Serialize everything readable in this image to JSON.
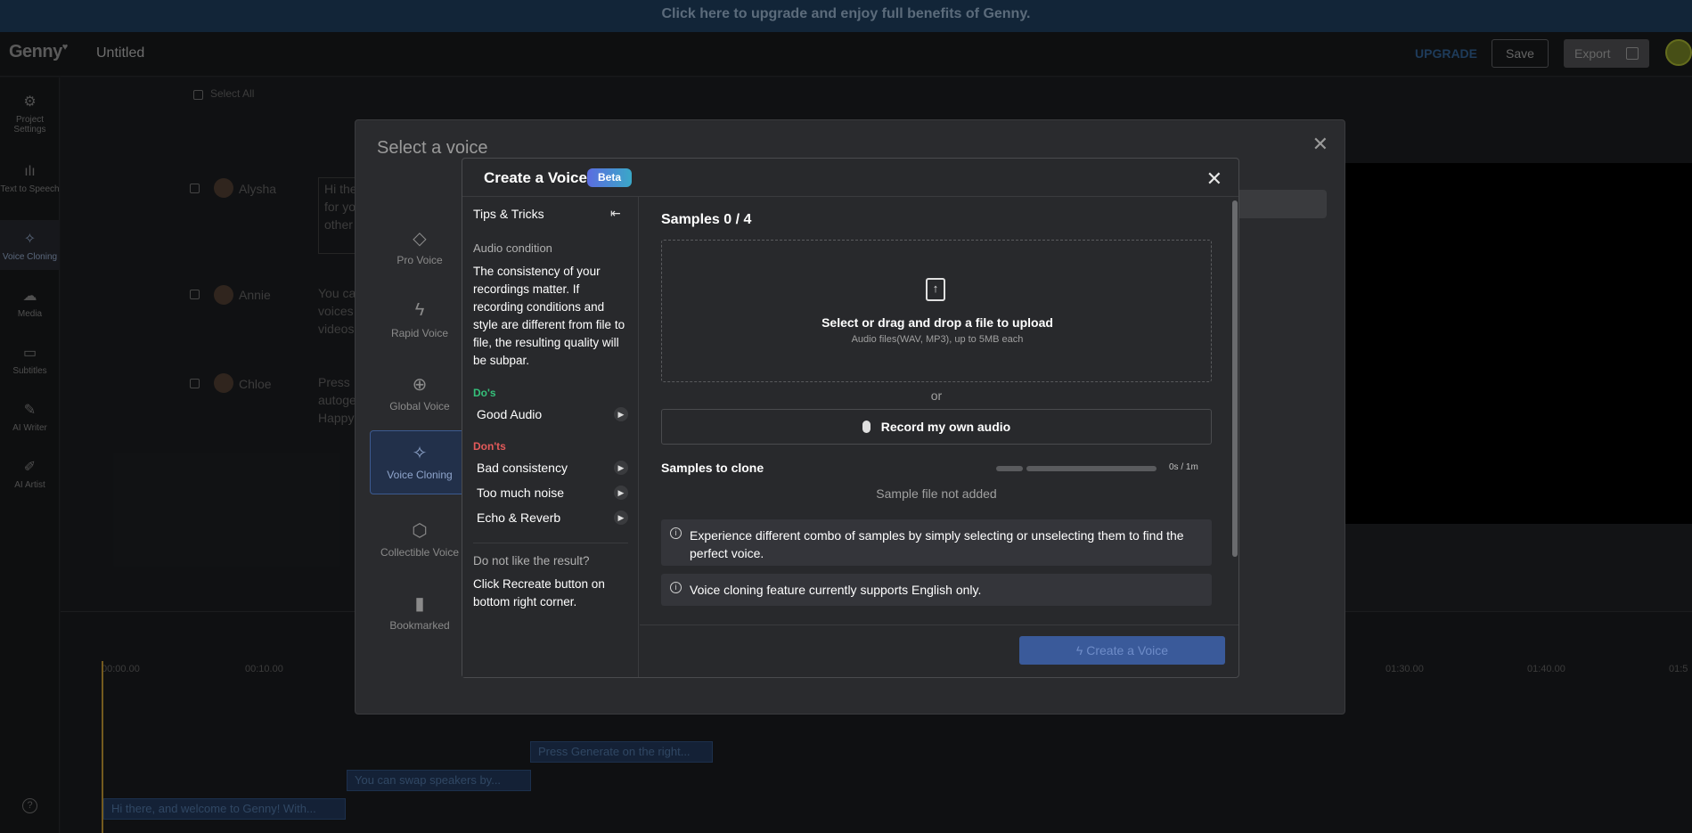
{
  "banner": {
    "text": "Click here to upgrade and enjoy full benefits of Genny."
  },
  "header": {
    "logo": "Genny",
    "doc_title": "Untitled",
    "upgrade": "UPGRADE",
    "save": "Save",
    "export": "Export"
  },
  "sidebar": {
    "items": [
      {
        "label": "Project Settings",
        "icon": "gear-icon"
      },
      {
        "label": "Text to Speech",
        "icon": "waveform-icon"
      },
      {
        "label": "Voice Cloning",
        "icon": "sparkle-icon",
        "active": true
      },
      {
        "label": "Media",
        "icon": "cloud-upload-icon"
      },
      {
        "label": "Subtitles",
        "icon": "subtitles-icon"
      },
      {
        "label": "AI Writer",
        "icon": "pen-icon"
      },
      {
        "label": "AI Artist",
        "icon": "brush-icon"
      }
    ],
    "help": "?"
  },
  "editor": {
    "select_all": "Select All",
    "speakers": [
      {
        "name": "Alysha",
        "text": "Hi the\nfor you\nother c"
      },
      {
        "name": "Annie",
        "text": "You ca\nvoices\nvideos"
      },
      {
        "name": "Chloe",
        "text": "Press\nautoge\nHappy"
      }
    ]
  },
  "timeline": {
    "times": [
      "00:00.00",
      "00:10.00",
      "01:30.00",
      "01:40.00",
      "01:5"
    ],
    "clips": [
      "Press Generate on the right...",
      "You can swap speakers by...",
      "Hi there, and welcome to Genny! With..."
    ]
  },
  "outer_modal": {
    "title": "Select a voice",
    "categories": [
      {
        "label": "Pro Voice",
        "icon": "diamond-icon"
      },
      {
        "label": "Rapid Voice",
        "icon": "lightning-icon"
      },
      {
        "label": "Global Voice",
        "icon": "globe-translate-icon"
      },
      {
        "label": "Voice Cloning",
        "icon": "sparkle-icon",
        "active": true
      },
      {
        "label": "Collectible Voice",
        "icon": "cube-icon"
      },
      {
        "label": "Bookmarked",
        "icon": "bookmark-icon"
      }
    ]
  },
  "create_modal": {
    "title": "Create a Voice",
    "badge": "Beta",
    "tips": {
      "title": "Tips & Tricks",
      "condition_heading": "Audio condition",
      "condition_body": "The consistency of your recordings matter. If recording conditions and style are different from file to file, the resulting quality will be subpar.",
      "dos_heading": "Do's",
      "dos": [
        "Good Audio"
      ],
      "donts_heading": "Don'ts",
      "donts": [
        "Bad consistency",
        "Too much noise",
        "Echo & Reverb"
      ],
      "question": "Do not like the result?",
      "answer": "Click Recreate button on bottom right corner."
    },
    "samples_heading": "Samples 0 / 4",
    "dropzone": {
      "main": "Select or drag and drop a file to upload",
      "sub": "Audio files(WAV, MP3), up to 5MB each"
    },
    "or": "or",
    "record_label": "Record my own audio",
    "samples_to_clone": "Samples to clone",
    "duration": "0s / 1m",
    "not_added": "Sample file not added",
    "info1": "Experience different combo of samples by simply selecting or unselecting them to find the perfect voice.",
    "info2": "Voice cloning feature currently supports English only.",
    "create_button": "Create a Voice"
  }
}
